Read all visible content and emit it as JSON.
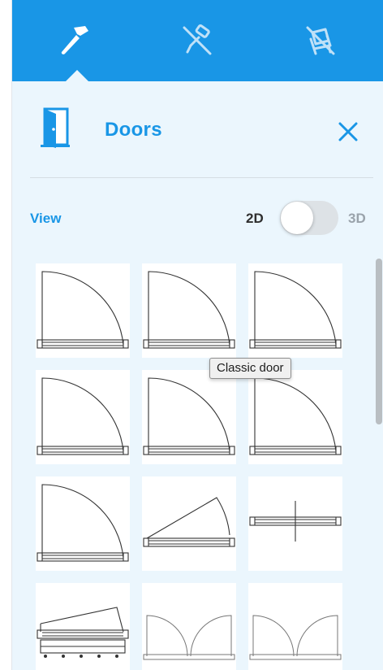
{
  "toolbar": {
    "tools": [
      {
        "icon": "hammer-icon",
        "active": true
      },
      {
        "icon": "paint-roller-icon",
        "active": false
      },
      {
        "icon": "armchair-icon",
        "active": false
      }
    ],
    "accent_color": "#1996e6"
  },
  "header": {
    "icon": "door-icon",
    "title": "Doors",
    "close_icon": "close-icon"
  },
  "view": {
    "label": "View",
    "option_2d": "2D",
    "option_3d": "3D",
    "selected": "2D"
  },
  "catalog": {
    "items": [
      {
        "kind": "swing-door"
      },
      {
        "kind": "swing-door"
      },
      {
        "kind": "swing-door"
      },
      {
        "kind": "swing-door"
      },
      {
        "kind": "swing-door"
      },
      {
        "kind": "swing-door"
      },
      {
        "kind": "swing-door"
      },
      {
        "kind": "partial-swing-door"
      },
      {
        "kind": "pivot-door"
      },
      {
        "kind": "garage-door"
      },
      {
        "kind": "double-door"
      },
      {
        "kind": "double-door"
      }
    ]
  },
  "tooltip": {
    "text": "Classic door"
  },
  "colors": {
    "panel_bg": "#ebf6fd",
    "toolbar_bg": "#1996e6",
    "line": "#333333"
  }
}
